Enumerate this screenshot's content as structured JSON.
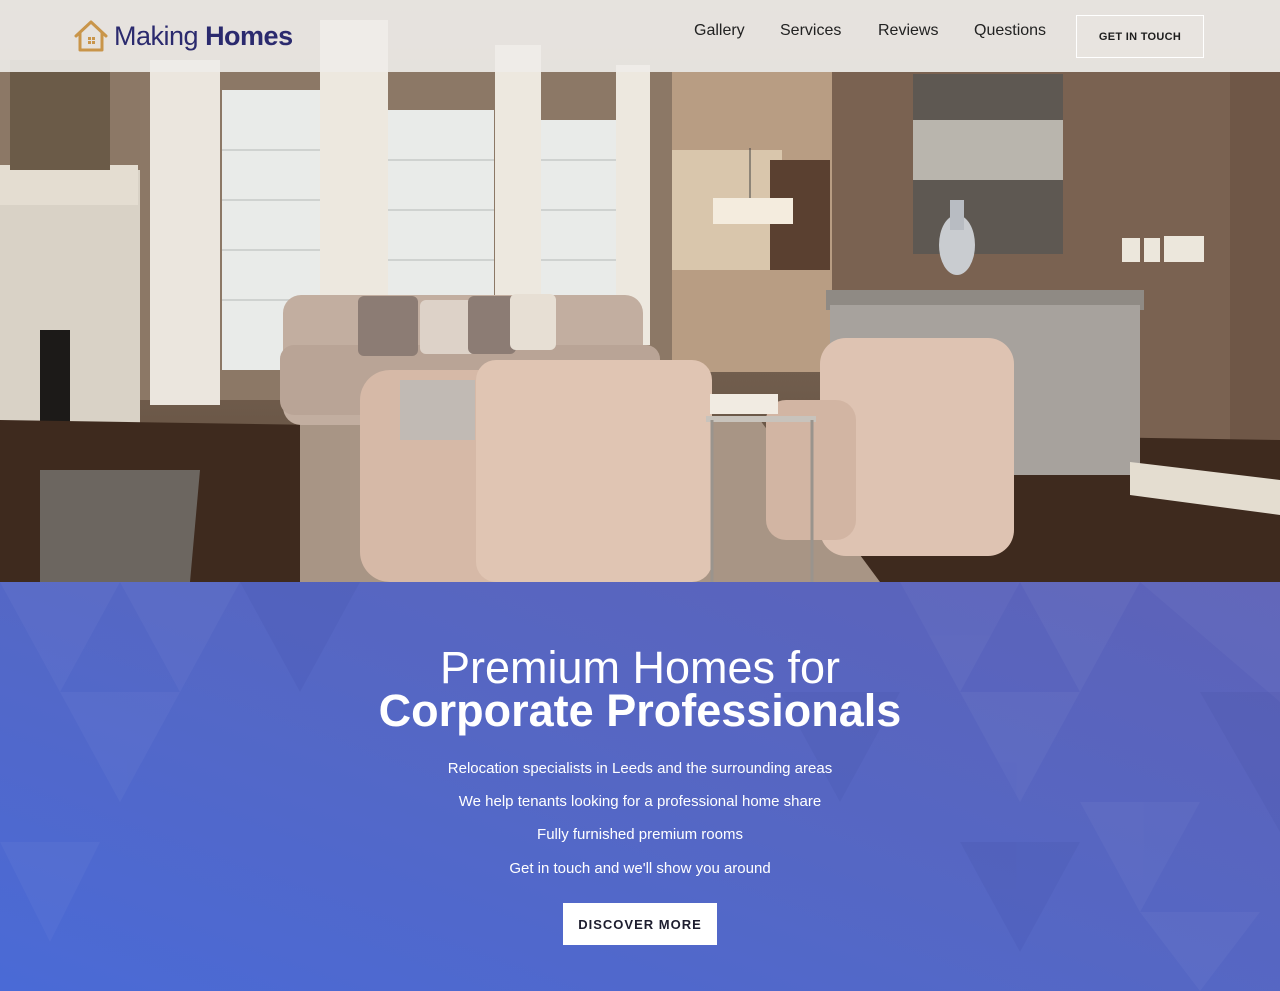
{
  "brand": {
    "name_light": "Making",
    "name_bold": "Homes",
    "logo_icon": "house-icon",
    "color_primary": "#2b2a6e",
    "color_icon": "#c9954a"
  },
  "nav": {
    "items": [
      {
        "label": "Gallery"
      },
      {
        "label": "Services"
      },
      {
        "label": "Reviews"
      },
      {
        "label": "Questions"
      }
    ],
    "cta_label": "GET IN TOUCH"
  },
  "hero": {
    "image_icon": "living-room-photo"
  },
  "promo": {
    "title_line1": "Premium Homes for",
    "title_line2": "Corporate Professionals",
    "lines": [
      "Relocation specialists in Leeds and the surrounding areas",
      "We help tenants looking for a professional home share",
      "Fully furnished premium rooms",
      "Get in touch and we'll show you around"
    ],
    "button_label": "DISCOVER MORE",
    "bg_color_start": "#5d62b8",
    "bg_color_end": "#4a6ad6"
  }
}
